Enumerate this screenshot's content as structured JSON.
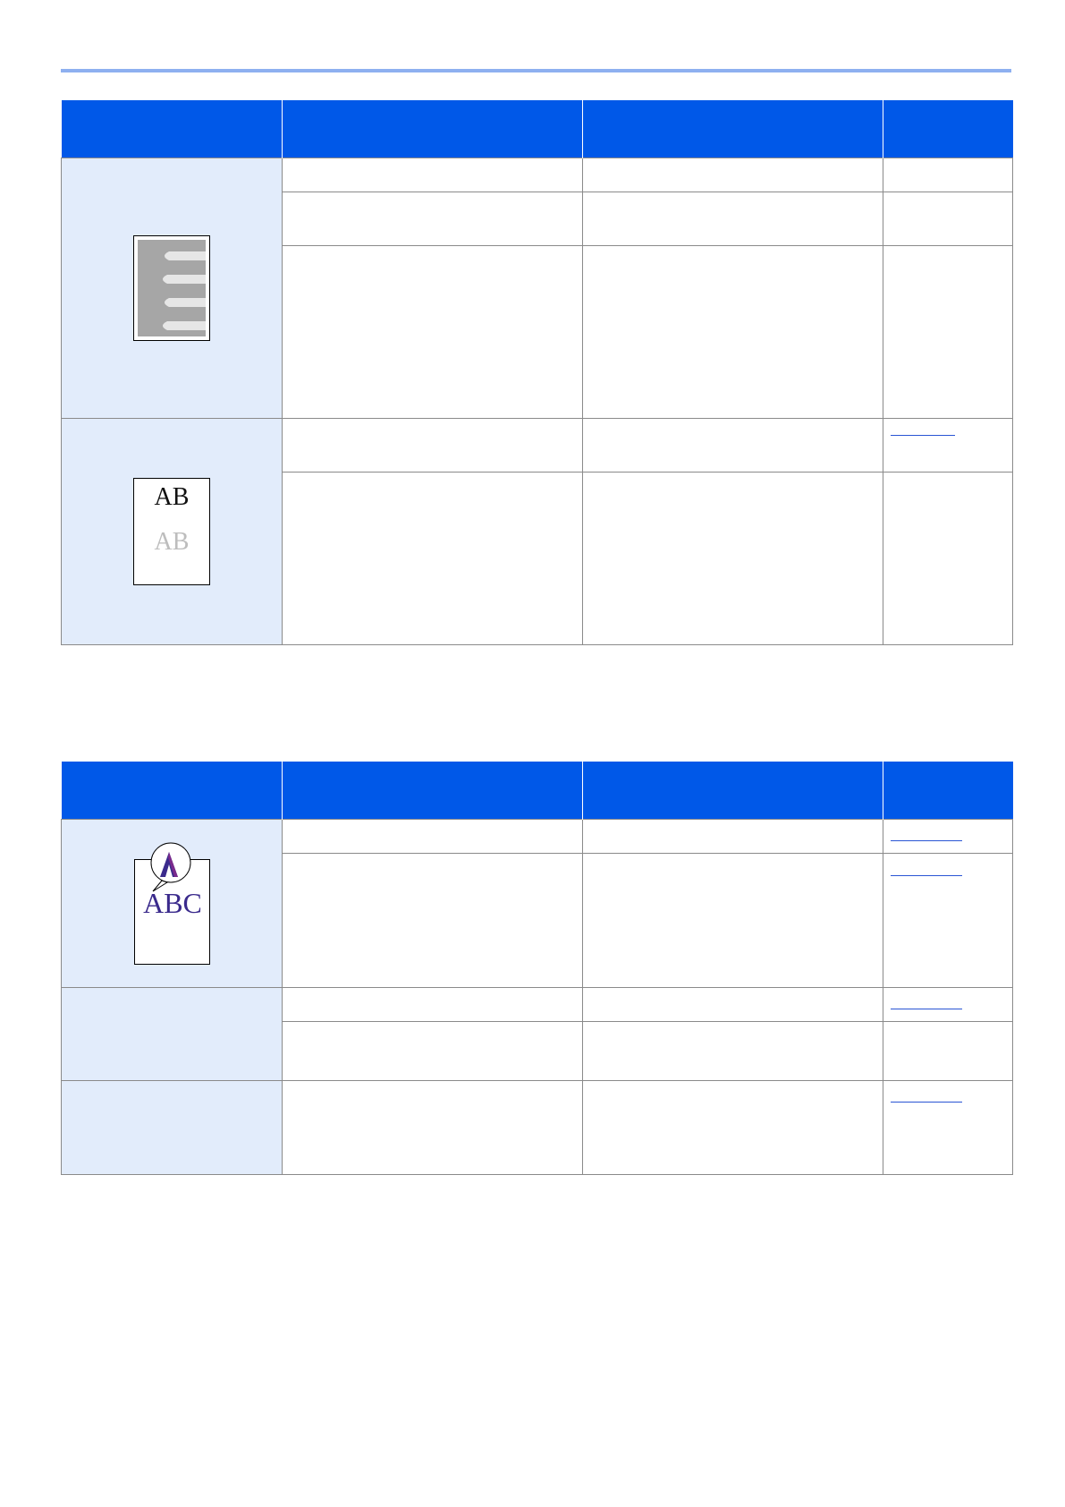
{
  "colors": {
    "header_bg": "#0058e8",
    "symptom_bg": "#e2ecfb",
    "top_rule": "#8eb0f0",
    "link": "#2a55d4",
    "abc_text": "#3a2a8c"
  },
  "illustrations": {
    "faint_stripes": {
      "icon": "white-stripes-on-gray-page-icon"
    },
    "ghost_image": {
      "icon": "ghost-ab-page-icon",
      "line1": "AB",
      "line2": "AB"
    },
    "misprint_abc": {
      "icon": "magnified-abc-page-icon",
      "magnified": "A",
      "text": "ABC"
    }
  }
}
